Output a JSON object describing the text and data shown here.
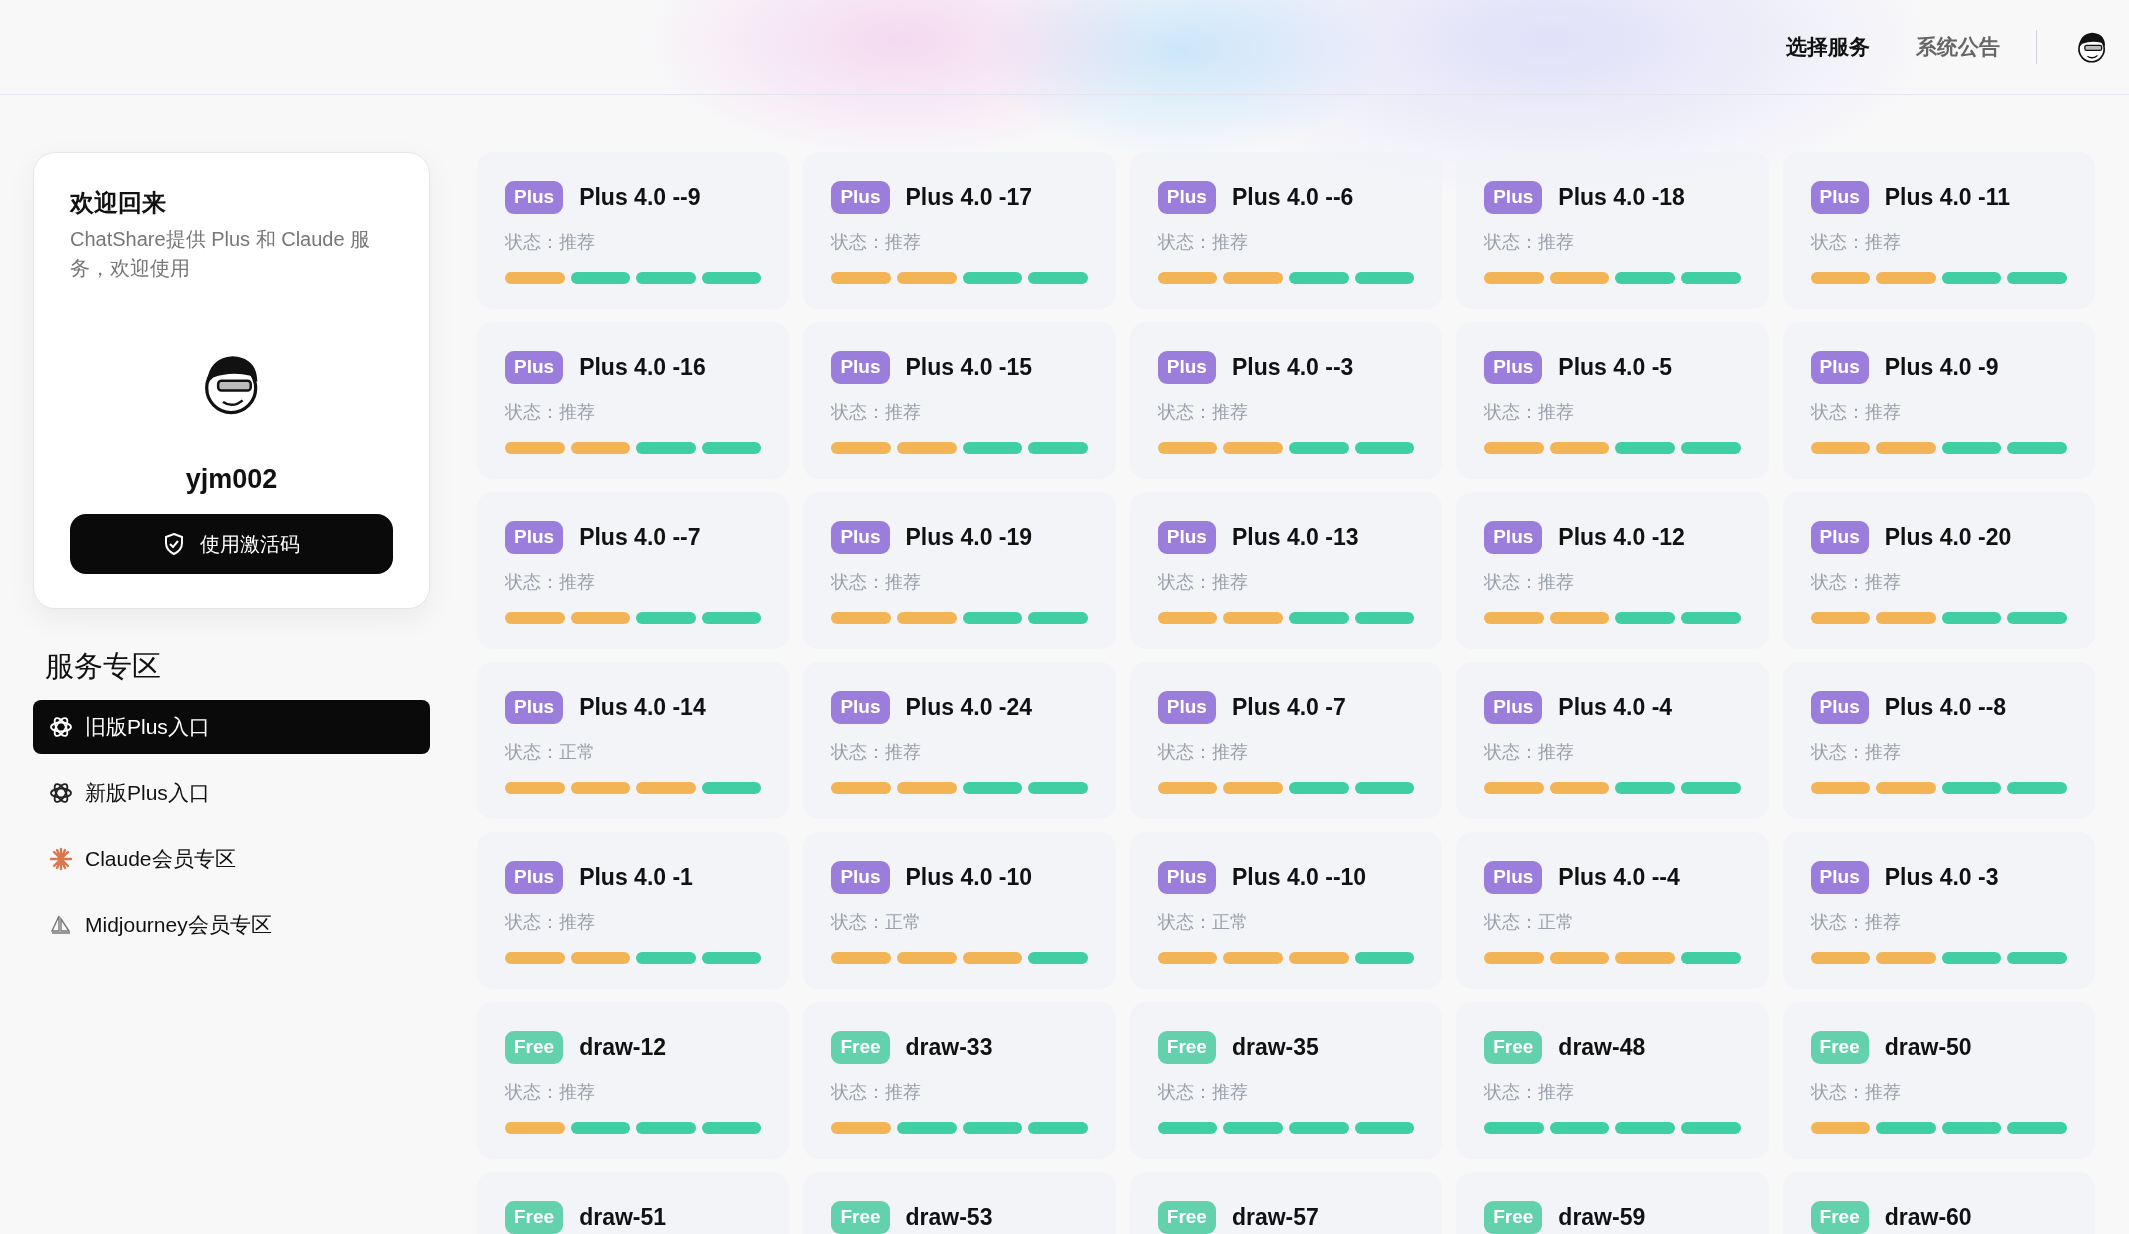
{
  "nav": {
    "items": [
      {
        "label": "选择服务",
        "selected": true
      },
      {
        "label": "系统公告",
        "selected": false
      }
    ]
  },
  "welcome": {
    "title": "欢迎回来",
    "subtitle": "ChatShare提供 Plus 和 Claude 服务，欢迎使用",
    "username": "yjm002",
    "button": "使用激活码"
  },
  "sidebar": {
    "title": "服务专区",
    "items": [
      {
        "label": "旧版Plus入口",
        "kind": "openai",
        "selected": true
      },
      {
        "label": "新版Plus入口",
        "kind": "openai",
        "selected": false
      },
      {
        "label": "Claude会员专区",
        "kind": "claude",
        "selected": false
      },
      {
        "label": "Midjourney会员专区",
        "kind": "midjourney",
        "selected": false
      }
    ]
  },
  "services": [
    {
      "tier": "Plus",
      "kind": "plus",
      "name": "Plus 4.0 --9",
      "status": "状态：推荐",
      "segments": [
        {
          "color": "#f2b455"
        },
        {
          "color": "#3fcfa2"
        },
        {
          "color": "#3fcfa2"
        },
        {
          "color": "#3fcfa2"
        }
      ]
    },
    {
      "tier": "Plus",
      "kind": "plus",
      "name": "Plus 4.0 -17",
      "status": "状态：推荐",
      "segments": [
        {
          "color": "#f2b455"
        },
        {
          "color": "#f2b455"
        },
        {
          "color": "#3fcfa2"
        },
        {
          "color": "#3fcfa2"
        }
      ]
    },
    {
      "tier": "Plus",
      "kind": "plus",
      "name": "Plus 4.0 --6",
      "status": "状态：推荐",
      "segments": [
        {
          "color": "#f2b455"
        },
        {
          "color": "#f2b455"
        },
        {
          "color": "#3fcfa2"
        },
        {
          "color": "#3fcfa2"
        }
      ]
    },
    {
      "tier": "Plus",
      "kind": "plus",
      "name": "Plus 4.0 -18",
      "status": "状态：推荐",
      "segments": [
        {
          "color": "#f2b455"
        },
        {
          "color": "#f2b455"
        },
        {
          "color": "#3fcfa2"
        },
        {
          "color": "#3fcfa2"
        }
      ]
    },
    {
      "tier": "Plus",
      "kind": "plus",
      "name": "Plus 4.0 -11",
      "status": "状态：推荐",
      "segments": [
        {
          "color": "#f2b455"
        },
        {
          "color": "#f2b455"
        },
        {
          "color": "#3fcfa2"
        },
        {
          "color": "#3fcfa2"
        }
      ]
    },
    {
      "tier": "Plus",
      "kind": "plus",
      "name": "Plus 4.0 -16",
      "status": "状态：推荐",
      "segments": [
        {
          "color": "#f2b455"
        },
        {
          "color": "#f2b455"
        },
        {
          "color": "#3fcfa2"
        },
        {
          "color": "#3fcfa2"
        }
      ]
    },
    {
      "tier": "Plus",
      "kind": "plus",
      "name": "Plus 4.0 -15",
      "status": "状态：推荐",
      "segments": [
        {
          "color": "#f2b455"
        },
        {
          "color": "#f2b455"
        },
        {
          "color": "#3fcfa2"
        },
        {
          "color": "#3fcfa2"
        }
      ]
    },
    {
      "tier": "Plus",
      "kind": "plus",
      "name": "Plus 4.0 --3",
      "status": "状态：推荐",
      "segments": [
        {
          "color": "#f2b455"
        },
        {
          "color": "#f2b455"
        },
        {
          "color": "#3fcfa2"
        },
        {
          "color": "#3fcfa2"
        }
      ]
    },
    {
      "tier": "Plus",
      "kind": "plus",
      "name": "Plus 4.0 -5",
      "status": "状态：推荐",
      "segments": [
        {
          "color": "#f2b455"
        },
        {
          "color": "#f2b455"
        },
        {
          "color": "#3fcfa2"
        },
        {
          "color": "#3fcfa2"
        }
      ]
    },
    {
      "tier": "Plus",
      "kind": "plus",
      "name": "Plus 4.0 -9",
      "status": "状态：推荐",
      "segments": [
        {
          "color": "#f2b455"
        },
        {
          "color": "#f2b455"
        },
        {
          "color": "#3fcfa2"
        },
        {
          "color": "#3fcfa2"
        }
      ]
    },
    {
      "tier": "Plus",
      "kind": "plus",
      "name": "Plus 4.0 --7",
      "status": "状态：推荐",
      "segments": [
        {
          "color": "#f2b455"
        },
        {
          "color": "#f2b455"
        },
        {
          "color": "#3fcfa2"
        },
        {
          "color": "#3fcfa2"
        }
      ]
    },
    {
      "tier": "Plus",
      "kind": "plus",
      "name": "Plus 4.0 -19",
      "status": "状态：推荐",
      "segments": [
        {
          "color": "#f2b455"
        },
        {
          "color": "#f2b455"
        },
        {
          "color": "#3fcfa2"
        },
        {
          "color": "#3fcfa2"
        }
      ]
    },
    {
      "tier": "Plus",
      "kind": "plus",
      "name": "Plus 4.0 -13",
      "status": "状态：推荐",
      "segments": [
        {
          "color": "#f2b455"
        },
        {
          "color": "#f2b455"
        },
        {
          "color": "#3fcfa2"
        },
        {
          "color": "#3fcfa2"
        }
      ]
    },
    {
      "tier": "Plus",
      "kind": "plus",
      "name": "Plus 4.0 -12",
      "status": "状态：推荐",
      "segments": [
        {
          "color": "#f2b455"
        },
        {
          "color": "#f2b455"
        },
        {
          "color": "#3fcfa2"
        },
        {
          "color": "#3fcfa2"
        }
      ]
    },
    {
      "tier": "Plus",
      "kind": "plus",
      "name": "Plus 4.0 -20",
      "status": "状态：推荐",
      "segments": [
        {
          "color": "#f2b455"
        },
        {
          "color": "#f2b455"
        },
        {
          "color": "#3fcfa2"
        },
        {
          "color": "#3fcfa2"
        }
      ]
    },
    {
      "tier": "Plus",
      "kind": "plus",
      "name": "Plus 4.0 -14",
      "status": "状态：正常",
      "segments": [
        {
          "color": "#f2b455"
        },
        {
          "color": "#f2b455"
        },
        {
          "color": "#f2b455"
        },
        {
          "color": "#3fcfa2"
        }
      ]
    },
    {
      "tier": "Plus",
      "kind": "plus",
      "name": "Plus 4.0 -24",
      "status": "状态：推荐",
      "segments": [
        {
          "color": "#f2b455"
        },
        {
          "color": "#f2b455"
        },
        {
          "color": "#3fcfa2"
        },
        {
          "color": "#3fcfa2"
        }
      ]
    },
    {
      "tier": "Plus",
      "kind": "plus",
      "name": "Plus 4.0 -7",
      "status": "状态：推荐",
      "segments": [
        {
          "color": "#f2b455"
        },
        {
          "color": "#f2b455"
        },
        {
          "color": "#3fcfa2"
        },
        {
          "color": "#3fcfa2"
        }
      ]
    },
    {
      "tier": "Plus",
      "kind": "plus",
      "name": "Plus 4.0 -4",
      "status": "状态：推荐",
      "segments": [
        {
          "color": "#f2b455"
        },
        {
          "color": "#f2b455"
        },
        {
          "color": "#3fcfa2"
        },
        {
          "color": "#3fcfa2"
        }
      ]
    },
    {
      "tier": "Plus",
      "kind": "plus",
      "name": "Plus 4.0 --8",
      "status": "状态：推荐",
      "segments": [
        {
          "color": "#f2b455"
        },
        {
          "color": "#f2b455"
        },
        {
          "color": "#3fcfa2"
        },
        {
          "color": "#3fcfa2"
        }
      ]
    },
    {
      "tier": "Plus",
      "kind": "plus",
      "name": "Plus 4.0 -1",
      "status": "状态：推荐",
      "segments": [
        {
          "color": "#f2b455"
        },
        {
          "color": "#f2b455"
        },
        {
          "color": "#3fcfa2"
        },
        {
          "color": "#3fcfa2"
        }
      ]
    },
    {
      "tier": "Plus",
      "kind": "plus",
      "name": "Plus 4.0 -10",
      "status": "状态：正常",
      "segments": [
        {
          "color": "#f2b455"
        },
        {
          "color": "#f2b455"
        },
        {
          "color": "#f2b455"
        },
        {
          "color": "#3fcfa2"
        }
      ]
    },
    {
      "tier": "Plus",
      "kind": "plus",
      "name": "Plus 4.0 --10",
      "status": "状态：正常",
      "segments": [
        {
          "color": "#f2b455"
        },
        {
          "color": "#f2b455"
        },
        {
          "color": "#f2b455"
        },
        {
          "color": "#3fcfa2"
        }
      ]
    },
    {
      "tier": "Plus",
      "kind": "plus",
      "name": "Plus 4.0 --4",
      "status": "状态：正常",
      "segments": [
        {
          "color": "#f2b455"
        },
        {
          "color": "#f2b455"
        },
        {
          "color": "#f2b455"
        },
        {
          "color": "#3fcfa2"
        }
      ]
    },
    {
      "tier": "Plus",
      "kind": "plus",
      "name": "Plus 4.0 -3",
      "status": "状态：推荐",
      "segments": [
        {
          "color": "#f2b455"
        },
        {
          "color": "#f2b455"
        },
        {
          "color": "#3fcfa2"
        },
        {
          "color": "#3fcfa2"
        }
      ]
    },
    {
      "tier": "Free",
      "kind": "free",
      "name": "draw-12",
      "status": "状态：推荐",
      "segments": [
        {
          "color": "#f2b455"
        },
        {
          "color": "#3fcfa2"
        },
        {
          "color": "#3fcfa2"
        },
        {
          "color": "#3fcfa2"
        }
      ]
    },
    {
      "tier": "Free",
      "kind": "free",
      "name": "draw-33",
      "status": "状态：推荐",
      "segments": [
        {
          "color": "#f2b455"
        },
        {
          "color": "#3fcfa2"
        },
        {
          "color": "#3fcfa2"
        },
        {
          "color": "#3fcfa2"
        }
      ]
    },
    {
      "tier": "Free",
      "kind": "free",
      "name": "draw-35",
      "status": "状态：推荐",
      "segments": [
        {
          "color": "#3fcfa2"
        },
        {
          "color": "#3fcfa2"
        },
        {
          "color": "#3fcfa2"
        },
        {
          "color": "#3fcfa2"
        }
      ]
    },
    {
      "tier": "Free",
      "kind": "free",
      "name": "draw-48",
      "status": "状态：推荐",
      "segments": [
        {
          "color": "#3fcfa2"
        },
        {
          "color": "#3fcfa2"
        },
        {
          "color": "#3fcfa2"
        },
        {
          "color": "#3fcfa2"
        }
      ]
    },
    {
      "tier": "Free",
      "kind": "free",
      "name": "draw-50",
      "status": "状态：推荐",
      "segments": [
        {
          "color": "#f2b455"
        },
        {
          "color": "#3fcfa2"
        },
        {
          "color": "#3fcfa2"
        },
        {
          "color": "#3fcfa2"
        }
      ]
    },
    {
      "tier": "Free",
      "kind": "free",
      "name": "draw-51"
    },
    {
      "tier": "Free",
      "kind": "free",
      "name": "draw-53"
    },
    {
      "tier": "Free",
      "kind": "free",
      "name": "draw-57"
    },
    {
      "tier": "Free",
      "kind": "free",
      "name": "draw-59"
    },
    {
      "tier": "Free",
      "kind": "free",
      "name": "draw-60"
    }
  ]
}
